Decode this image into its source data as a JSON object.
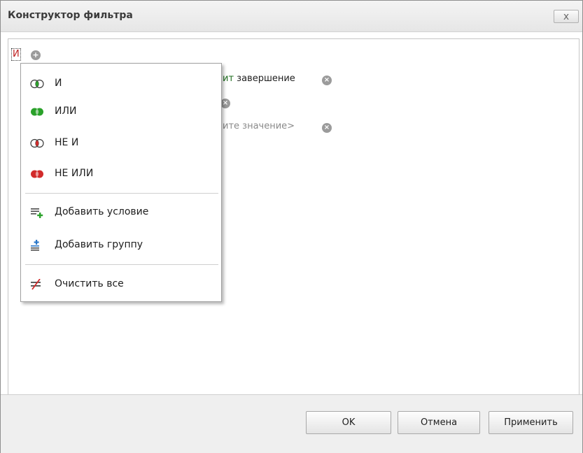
{
  "window": {
    "title": "Конструктор фильтра",
    "close_label": "x"
  },
  "filter": {
    "root_operator": "И",
    "add_icon": "+",
    "remove_icon": "×",
    "conditions": [
      {
        "visible_prefix": "ит",
        "visible_value": "завершение"
      },
      {
        "visible_text": ""
      },
      {
        "visible_text": "ите значение>"
      }
    ]
  },
  "context_menu": {
    "groups": {
      "and": "И",
      "or": "ИЛИ",
      "not_and": "НЕ И",
      "not_or": "НЕ ИЛИ"
    },
    "add_condition": "Добавить условие",
    "add_group": "Добавить группу",
    "clear_all": "Очистить все",
    "icons": {
      "and": "rings-and-icon",
      "or": "rings-or-icon",
      "not_and": "rings-not-and-icon",
      "not_or": "rings-not-or-icon",
      "add_condition": "add-condition-icon",
      "add_group": "add-group-icon",
      "clear_all": "clear-all-icon"
    }
  },
  "footer": {
    "ok": "OK",
    "cancel": "Отмена",
    "apply": "Применить"
  },
  "colors": {
    "green": "#2aa12a",
    "red": "#d22b2b",
    "operator_red": "#c01f1f",
    "condition_green": "#1f6e1f",
    "placeholder_gray": "#8a8a8a",
    "icon_gray": "#9b9b9b"
  }
}
